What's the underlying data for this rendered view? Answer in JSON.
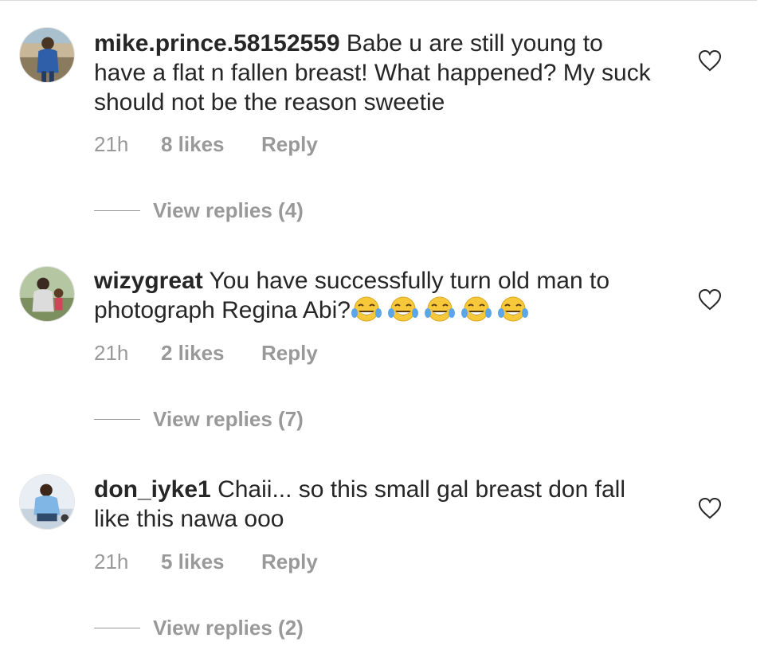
{
  "comments": [
    {
      "username": "mike.prince.58152559",
      "text": "Babe u are still young to have a flat n fallen breast! What happened? My suck should not be the reason sweetie",
      "time": "21h",
      "likes": "8 likes",
      "reply": "Reply",
      "view_replies": "View replies (4)",
      "icons": {
        "like": "heart-outline-icon",
        "avatar": "avatar-image"
      }
    },
    {
      "username": "wizygreat",
      "text": "You have successfully turn old man to photograph Regina Abi?",
      "emoji": [
        "face-with-tears-of-joy",
        "face-with-tears-of-joy",
        "face-with-tears-of-joy",
        "face-with-tears-of-joy",
        "face-with-tears-of-joy"
      ],
      "time": "21h",
      "likes": "2 likes",
      "reply": "Reply",
      "view_replies": "View replies (7)",
      "icons": {
        "like": "heart-outline-icon",
        "avatar": "avatar-image"
      }
    },
    {
      "username": "don_iyke1",
      "text": "Chaii... so this small gal breast don fall like this nawa ooo",
      "time": "21h",
      "likes": "5 likes",
      "reply": "Reply",
      "view_replies": "View replies (2)",
      "icons": {
        "like": "heart-outline-icon",
        "avatar": "avatar-image"
      }
    }
  ],
  "colors": {
    "text": "#262626",
    "secondary": "#999999",
    "divider": "#dbdbdb",
    "emoji_face": "#f7c93a"
  }
}
